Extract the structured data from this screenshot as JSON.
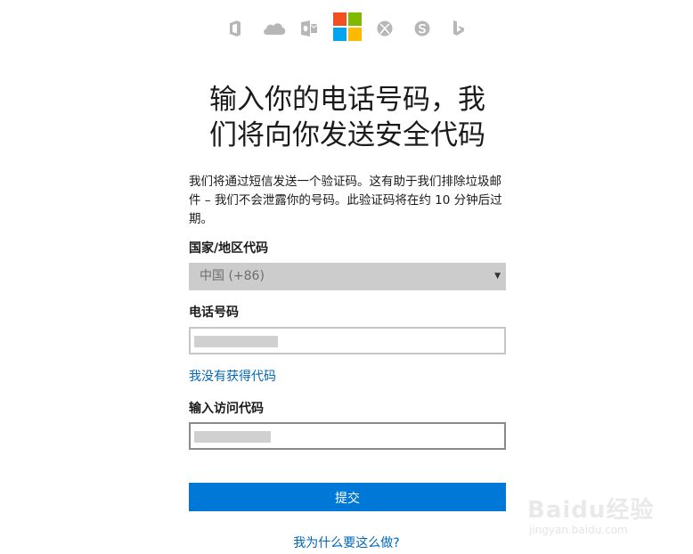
{
  "header": {
    "product_icons": [
      "office-icon",
      "onedrive-icon",
      "outlook-icon",
      "microsoft-logo",
      "xbox-icon",
      "skype-icon",
      "bing-icon"
    ],
    "logo_colors": [
      "#f25022",
      "#7fba00",
      "#00a4ef",
      "#ffb900"
    ]
  },
  "main": {
    "title_line1": "输入你的电话号码，我",
    "title_line2": "们将向你发送安全代码",
    "description": "我们将通过短信发送一个验证码。这有助于我们排除垃圾邮件 – 我们不会泄露你的号码。此验证码将在约 10 分钟后过期。",
    "country_label": "国家/地区代码",
    "country_value": "中国 (+86)",
    "phone_label": "电话号码",
    "no_code_link": "我没有获得代码",
    "access_code_label": "输入访问代码",
    "submit_label": "提交",
    "why_link": "我为什么要这么做?"
  },
  "watermark": {
    "brand": "Baidu经验",
    "url": "jingyan.baidu.com"
  },
  "colors": {
    "accent": "#0078d7",
    "link": "#0067b8",
    "select_bg": "#cccccc"
  }
}
